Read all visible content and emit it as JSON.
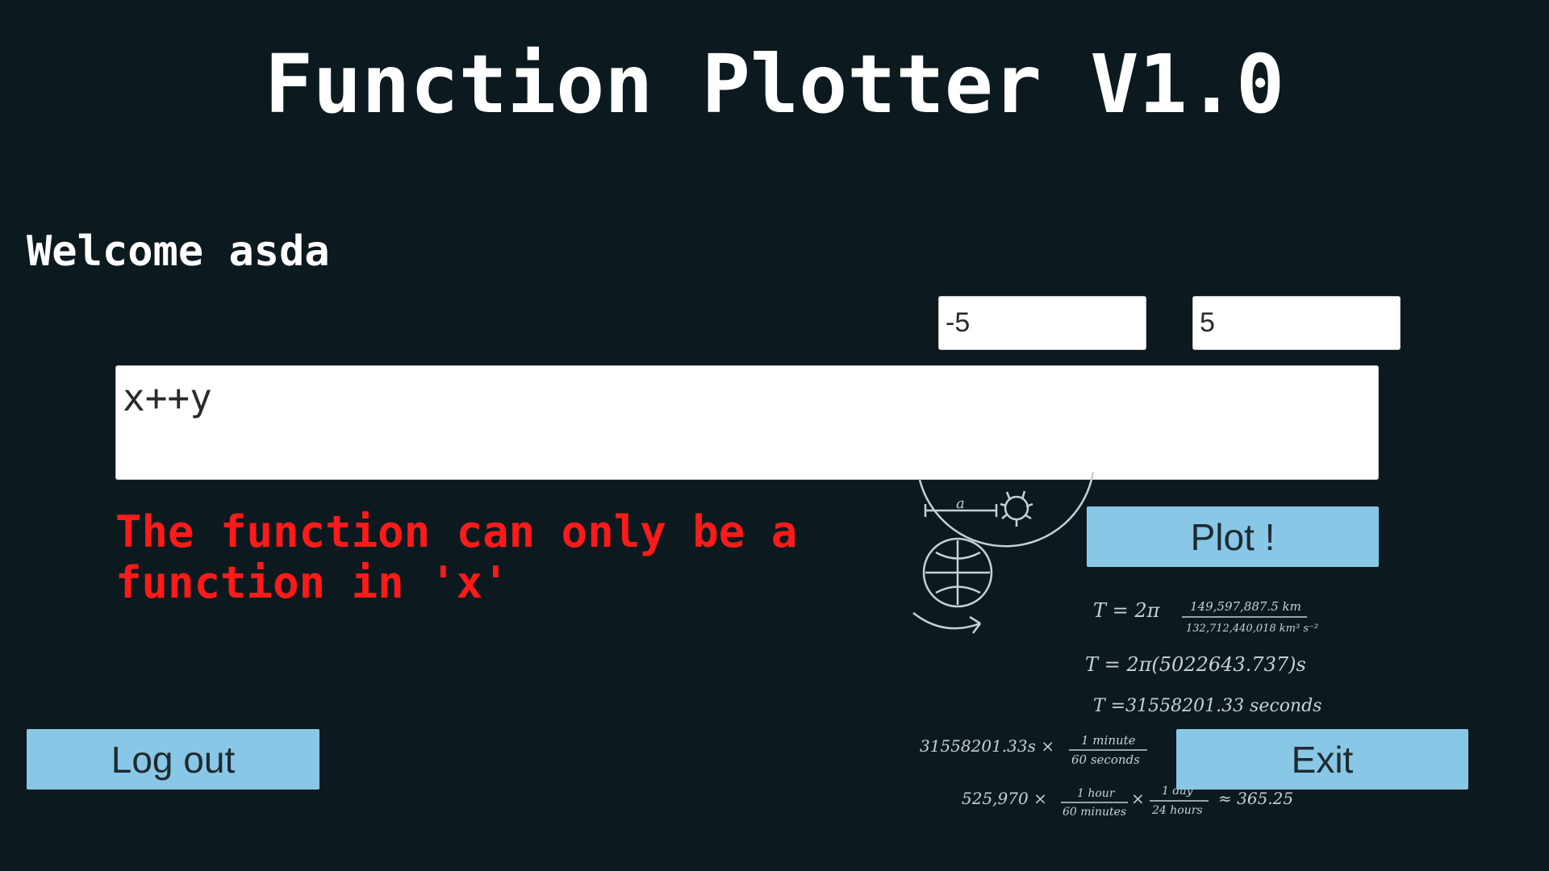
{
  "app": {
    "title": "Function Plotter V1.0"
  },
  "user": {
    "welcome": "Welcome asda"
  },
  "range": {
    "min_value": "-5",
    "max_value": "5"
  },
  "function_input": {
    "value": "x++y"
  },
  "error_message": "The function can only be a function in 'x'",
  "buttons": {
    "plot": "Plot !",
    "logout": "Log out",
    "exit": "Exit"
  },
  "colors": {
    "background": "#0c1a1f",
    "button": "#89c7e6",
    "error": "#ff1a1a",
    "title": "#ffffff"
  },
  "decoration": {
    "orbit_label": "a",
    "eq1": "T = 2π",
    "eq1_num": "149,597,887.5 km",
    "eq1_den": "132,712,440,018 km³ s⁻²",
    "eq2": "T = 2π(5022643.737)s",
    "eq3": "T =31558201.33 seconds",
    "eq4_left": "31558201.33s ×",
    "eq4_frac_num": "1 minute",
    "eq4_frac_den": "60 seconds",
    "eq5_left": "525,970 ×",
    "eq5_frac1_num": "1 hour",
    "eq5_frac1_den": "60 minutes",
    "eq5_frac2_num": "1 day",
    "eq5_frac2_den": "24 hours",
    "eq5_result": "≈ 365.25"
  }
}
